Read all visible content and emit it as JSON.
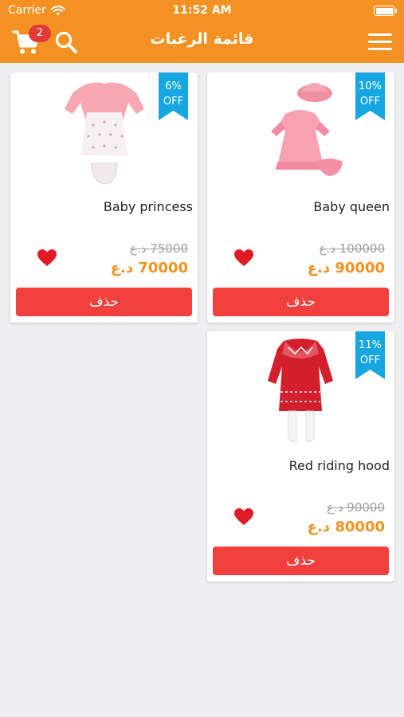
{
  "status_bar": {
    "carrier": "Carrier",
    "time": "11:52 AM"
  },
  "header": {
    "title": "قائمة الرغبات",
    "cart_count": "2",
    "icons": {
      "cart": "cart-icon",
      "search": "search-icon",
      "menu": "menu-icon"
    }
  },
  "colors": {
    "header": "#f39222",
    "ribbon": "#17a7e0",
    "delete_button": "#f43f3f",
    "price": "#f39222",
    "heart": "#e01b24"
  },
  "products": [
    {
      "name": "Baby queen",
      "discount_pct": "10%",
      "discount_off": "OFF",
      "old_price": "100000 د.ع",
      "new_price": "90000 د.ع",
      "delete_label": "حذف"
    },
    {
      "name": "Baby princess",
      "discount_pct": "6%",
      "discount_off": "OFF",
      "old_price": "75000 د.ع",
      "new_price": "70000 د.ع",
      "delete_label": "حذف"
    },
    {
      "name": "Red riding hood",
      "discount_pct": "11%",
      "discount_off": "OFF",
      "old_price": "90000 د.ع",
      "new_price": "80000 د.ع",
      "delete_label": "حذف"
    }
  ]
}
